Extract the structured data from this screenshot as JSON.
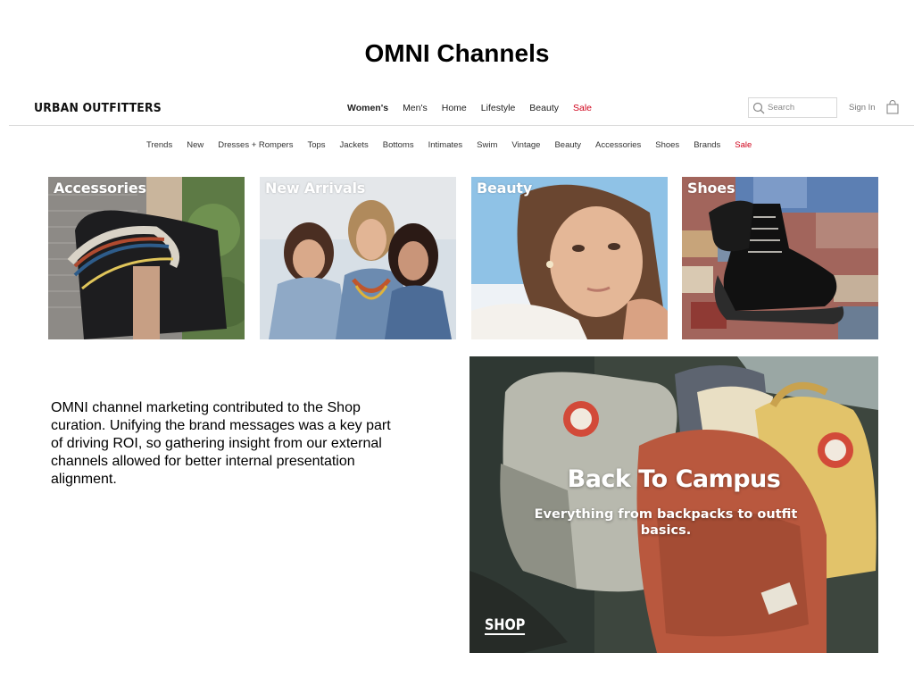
{
  "slide": {
    "title": "OMNI Channels"
  },
  "site": {
    "logo": "URBAN OUTFITTERS",
    "main_nav": [
      "Women's",
      "Men's",
      "Home",
      "Lifestyle",
      "Beauty",
      "Sale"
    ],
    "main_nav_active": "Women's",
    "search": {
      "placeholder": "Search"
    },
    "sign_in": "Sign In",
    "sub_nav": [
      "Trends",
      "New",
      "Dresses + Rompers",
      "Tops",
      "Jackets",
      "Bottoms",
      "Intimates",
      "Swim",
      "Vintage",
      "Beauty",
      "Accessories",
      "Shoes",
      "Brands",
      "Sale"
    ],
    "sale_color": "#d0021b"
  },
  "tiles": [
    {
      "label": "Accessories",
      "image": "woman-with-woven-tote-bag-photo"
    },
    {
      "label": "New Arrivals",
      "image": "three-women-in-denim-photo"
    },
    {
      "label": "Beauty",
      "image": "woman-portrait-photo"
    },
    {
      "label": "Shoes",
      "image": "black-leather-boots-on-quilt-photo"
    }
  ],
  "body_copy": "OMNI channel marketing contributed to the Shop curation. Unifying the brand messages was a key part of driving ROI, so gathering insight from our external channels allowed for better internal presentation alignment.",
  "promo": {
    "headline": "Back To Campus",
    "subline": "Everything from backpacks to outfit basics.",
    "cta": "SHOP",
    "image": "backpacks-photo"
  }
}
